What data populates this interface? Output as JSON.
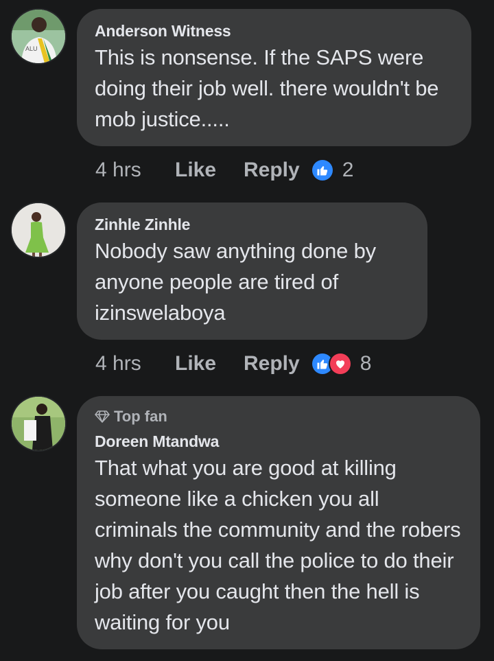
{
  "comments": [
    {
      "author": "Anderson Witness",
      "text": "This is nonsense. If the SAPS were doing their job well. there wouldn't be mob justice.....",
      "time": "4 hrs",
      "like_label": "Like",
      "reply_label": "Reply",
      "reactions": [
        "like-icon"
      ],
      "reaction_count": "2"
    },
    {
      "author": "Zinhle Zinhle",
      "text": "Nobody saw anything  done by anyone people are tired of izinswelaboya",
      "time": "4 hrs",
      "like_label": "Like",
      "reply_label": "Reply",
      "reactions": [
        "like-icon",
        "love-icon"
      ],
      "reaction_count": "8"
    },
    {
      "badge": "Top fan",
      "author": "Doreen Mtandwa",
      "text": "That what you are good at killing someone like a chicken you all criminals the community and the robers why don't you call the police to do their job after you caught then the hell is waiting for you"
    }
  ],
  "colors": {
    "background": "#18191a",
    "bubble": "#3a3b3c",
    "primary_text": "#e4e6eb",
    "secondary_text": "#b0b3b8",
    "like_blue": "#2e89ff",
    "love_red": "#f33e58"
  }
}
